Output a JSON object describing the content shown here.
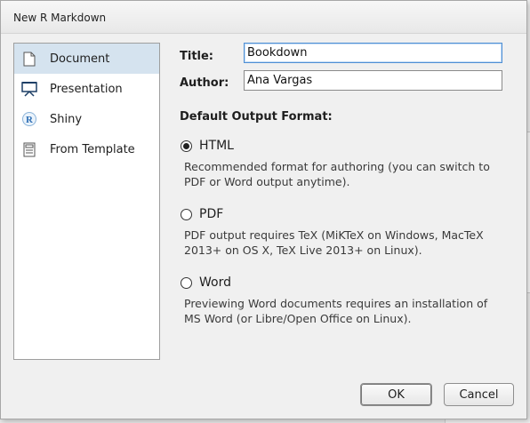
{
  "window": {
    "title": "New R Markdown"
  },
  "sidebar": {
    "items": [
      {
        "label": "Document",
        "icon": "document-icon",
        "selected": true
      },
      {
        "label": "Presentation",
        "icon": "presentation-icon",
        "selected": false
      },
      {
        "label": "Shiny",
        "icon": "shiny-r-icon",
        "selected": false
      },
      {
        "label": "From Template",
        "icon": "template-icon",
        "selected": false
      }
    ]
  },
  "form": {
    "title_label": "Title:",
    "title_value": "Bookdown",
    "author_label": "Author:",
    "author_value": "Ana Vargas"
  },
  "output": {
    "heading": "Default Output Format:",
    "options": [
      {
        "label": "HTML",
        "checked": true,
        "description": "Recommended format for authoring (you can switch to PDF or Word output anytime)."
      },
      {
        "label": "PDF",
        "checked": false,
        "description": "PDF output requires TeX (MiKTeX on Windows, MacTeX 2013+ on OS X, TeX Live 2013+ on Linux)."
      },
      {
        "label": "Word",
        "checked": false,
        "description": "Previewing Word documents requires an installation of MS Word (or Libre/Open Office on Linux)."
      }
    ]
  },
  "buttons": {
    "ok": "OK",
    "cancel": "Cancel"
  }
}
